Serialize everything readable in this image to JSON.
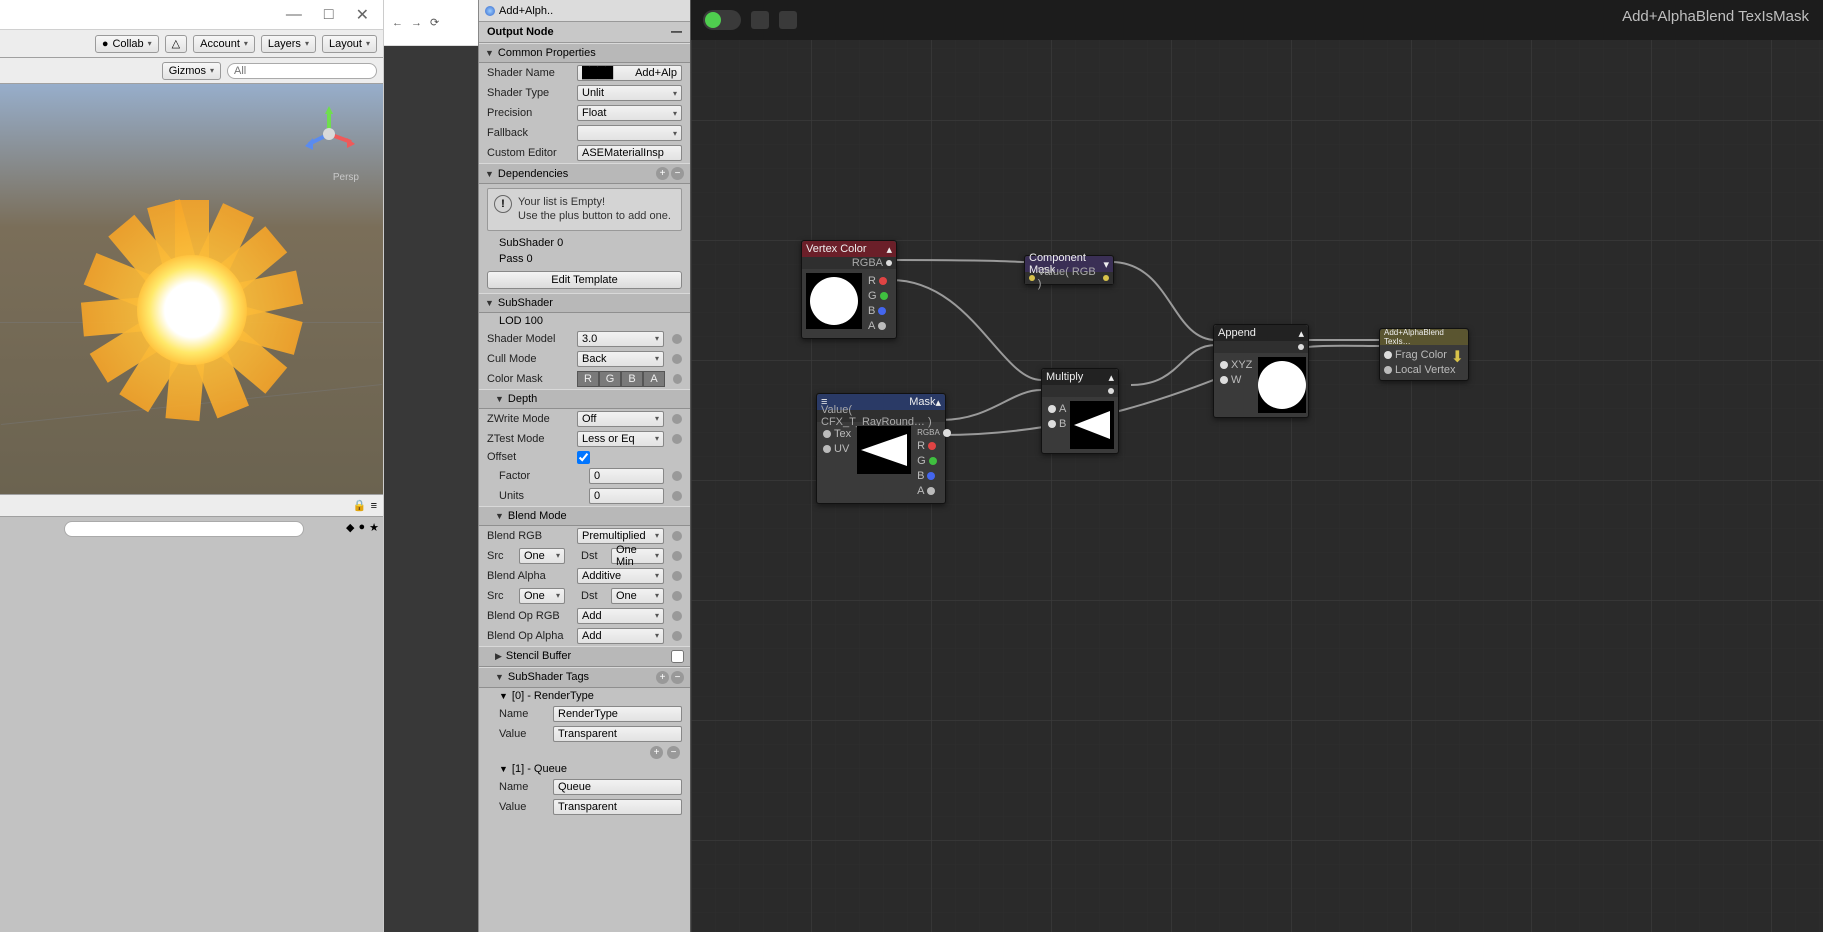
{
  "unity": {
    "titlebar": {
      "min": "—",
      "max": "□",
      "close": "✕"
    },
    "toolbar": {
      "collab": "Collab",
      "cloud": "△",
      "account": "Account",
      "layers": "Layers",
      "layout": "Layout"
    },
    "gizmos": "Gizmos",
    "search_placeholder": "All",
    "persp": "Persp"
  },
  "browser": {
    "back": "←",
    "fwd": "→",
    "reload": "⟳"
  },
  "inspector": {
    "tab": "Add+Alph..",
    "title": "Output Node",
    "sections": {
      "common": {
        "label": "Common Properties",
        "shader_name_lbl": "Shader Name",
        "shader_name_val": "Add+Alp",
        "shader_type_lbl": "Shader Type",
        "shader_type_val": "Unlit",
        "precision_lbl": "Precision",
        "precision_val": "Float",
        "fallback_lbl": "Fallback",
        "fallback_val": "",
        "custom_editor_lbl": "Custom Editor",
        "custom_editor_val": "ASEMaterialInsp"
      },
      "dependencies": {
        "label": "Dependencies",
        "empty1": "Your list is Empty!",
        "empty2": "Use the plus button to add one."
      },
      "subshader_info": {
        "sub": "SubShader 0",
        "pass": "Pass 0"
      },
      "edit_template": "Edit Template",
      "subshader": {
        "label": "SubShader",
        "lod": "LOD 100",
        "model_lbl": "Shader Model",
        "model_val": "3.0",
        "cull_lbl": "Cull Mode",
        "cull_val": "Back",
        "colormask_lbl": "Color Mask",
        "colormask": [
          "R",
          "G",
          "B",
          "A"
        ]
      },
      "depth": {
        "label": "Depth",
        "zwrite_lbl": "ZWrite Mode",
        "zwrite_val": "Off",
        "ztest_lbl": "ZTest Mode",
        "ztest_val": "Less or Eq",
        "offset_lbl": "Offset",
        "factor_lbl": "Factor",
        "factor_val": "0",
        "units_lbl": "Units",
        "units_val": "0"
      },
      "blend": {
        "label": "Blend Mode",
        "rgb_lbl": "Blend RGB",
        "rgb_val": "Premultiplied",
        "src_lbl": "Src",
        "src_val": "One",
        "dst_lbl": "Dst",
        "dst_val_rgb": "One Min",
        "alpha_lbl": "Blend Alpha",
        "alpha_val": "Additive",
        "dst_val_alpha": "One",
        "op_rgb_lbl": "Blend Op RGB",
        "op_rgb_val": "Add",
        "op_alpha_lbl": "Blend Op Alpha",
        "op_alpha_val": "Add"
      },
      "stencil": {
        "label": "Stencil Buffer"
      },
      "tags": {
        "label": "SubShader Tags",
        "t0": "[0] - RenderType",
        "name_lbl": "Name",
        "t0_name": "RenderType",
        "value_lbl": "Value",
        "t0_val": "Transparent",
        "t1": "[1] - Queue",
        "t1_name": "Queue",
        "t1_val": "Transparent"
      }
    }
  },
  "graph": {
    "title": "Add+AlphaBlend TexIsMask",
    "nodes": {
      "vertex_color": {
        "title": "Vertex Color",
        "sub": "RGBA",
        "ports": [
          "R",
          "G",
          "B",
          "A"
        ]
      },
      "comp_mask": {
        "title": "Component Mask",
        "sub": "Value( RGB )"
      },
      "mask": {
        "title": "Mask",
        "sub": "Value( CFX_T_RayRound… )",
        "in": [
          "Tex",
          "UV"
        ],
        "out": [
          "RGBA",
          "R",
          "G",
          "B",
          "A"
        ]
      },
      "multiply": {
        "title": "Multiply",
        "in": [
          "A",
          "B"
        ]
      },
      "append": {
        "title": "Append",
        "in": [
          "XYZ",
          "W"
        ]
      },
      "output": {
        "title": "Add+AlphaBlend TexIs…",
        "ports": [
          "Frag Color",
          "Local Vertex"
        ]
      }
    }
  }
}
